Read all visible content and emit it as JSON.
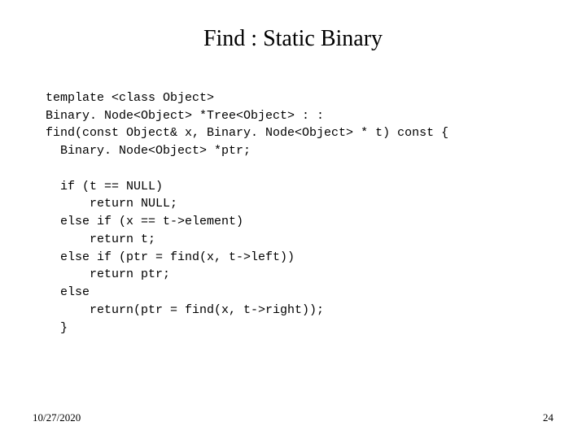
{
  "title": "Find : Static Binary",
  "code": {
    "l1": "template <class Object>",
    "l2": "Binary. Node<Object> *Tree<Object> : :",
    "l3": "find(const Object& x, Binary. Node<Object> * t) const {",
    "l4": "  Binary. Node<Object> *ptr;",
    "l5": "",
    "l6": "  if (t == NULL)",
    "l7": "      return NULL;",
    "l8": "  else if (x == t->element)",
    "l9": "      return t;",
    "l10": "  else if (ptr = find(x, t->left))",
    "l11": "      return ptr;",
    "l12": "  else",
    "l13": "      return(ptr = find(x, t->right));",
    "l14": "  }"
  },
  "footer": {
    "date": "10/27/2020",
    "page": "24"
  }
}
